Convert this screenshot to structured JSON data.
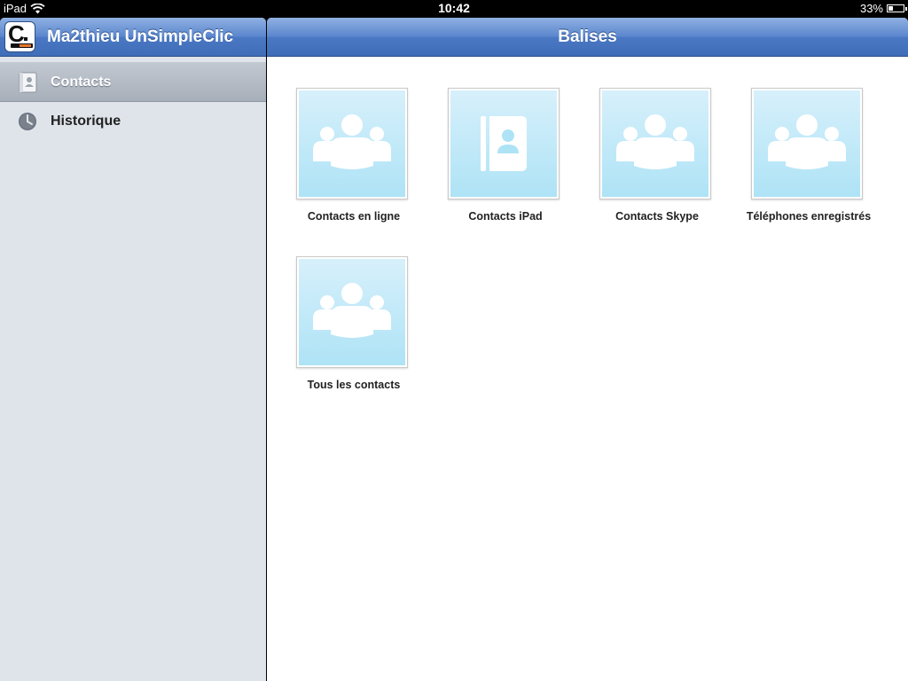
{
  "status_bar": {
    "device": "iPad",
    "time": "10:42",
    "battery": "33%",
    "battery_level": 0.33
  },
  "sidebar": {
    "title": "Ma2thieu UnSimpleClic",
    "items": [
      {
        "label": "Contacts",
        "icon": "contacts-book-icon",
        "selected": true
      },
      {
        "label": "Historique",
        "icon": "clock-icon",
        "selected": false
      }
    ]
  },
  "main": {
    "title": "Balises",
    "tiles": [
      {
        "label": "Contacts en ligne",
        "icon": "group-icon"
      },
      {
        "label": "Contacts iPad",
        "icon": "address-book-icon"
      },
      {
        "label": "Contacts Skype",
        "icon": "group-icon"
      },
      {
        "label": "Téléphones enregistrés",
        "icon": "group-icon"
      },
      {
        "label": "Tous les contacts",
        "icon": "group-icon"
      }
    ]
  },
  "colors": {
    "nav_bar": "#4a78c4",
    "sidebar_bg": "#dfe4ea",
    "tile_bg": "#aee3f6"
  }
}
